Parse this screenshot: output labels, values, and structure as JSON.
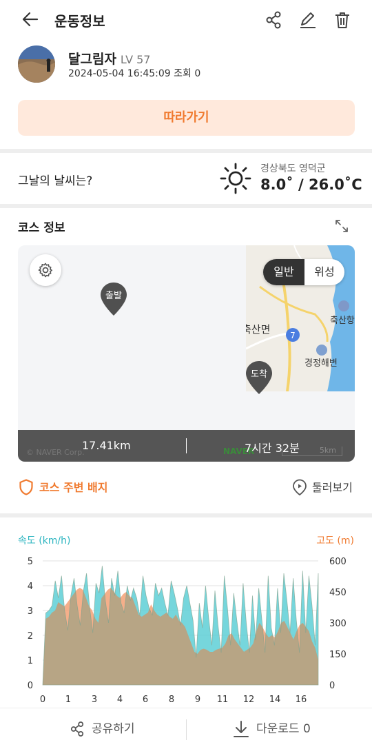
{
  "header": {
    "title": "운동정보"
  },
  "profile": {
    "name": "달그림자",
    "level": "LV 57",
    "meta": "2024-05-04 16:45:09 조회 0"
  },
  "follow_button": "따라가기",
  "weather": {
    "question": "그날의 날씨는?",
    "location": "경상북도 영덕군",
    "temperature": "8.0˚ / 26.0˚C"
  },
  "course": {
    "title": "코스 정보",
    "map_toggle": {
      "normal": "일반",
      "satellite": "위성"
    },
    "start_label": "출발",
    "end_label": "도착",
    "distance": "17.41km",
    "duration": "7시간 32분",
    "map_labels": {
      "place1": "축산항",
      "place2": "축산면",
      "beach": "경정해변",
      "route_no": "7"
    },
    "attribution": "© NAVER Corp.",
    "naver_mark": "NAVER",
    "scale": "5km"
  },
  "links": {
    "badge": "코스 주변 배지",
    "lookaround": "둘러보기"
  },
  "chart_data": {
    "type": "area",
    "ylabel_left": "속도 (km/h)",
    "ylabel_right": "고도 (m)",
    "x_ticks": [
      "0",
      "1",
      "3",
      "4",
      "6",
      "8",
      "9",
      "11",
      "12",
      "14",
      "16"
    ],
    "y_left_ticks": [
      "0",
      "1",
      "2",
      "3",
      "4",
      "5"
    ],
    "y_right_ticks": [
      "0",
      "150",
      "300",
      "450",
      "600"
    ],
    "ylim_left": [
      0,
      5
    ],
    "ylim_right": [
      0,
      600
    ],
    "colors": {
      "speed": "#5ecfd6",
      "altitude": "#f3a176",
      "overlap": "#b7a585"
    },
    "series": [
      {
        "values": [
          0,
          2.9,
          3,
          3.2,
          4.2,
          3.5,
          4.4,
          3,
          2.2,
          3.6,
          4.3,
          3.2,
          2.4,
          3.8,
          4.5,
          3.1,
          2.1,
          4.1,
          3.7,
          4.8,
          3.4,
          2.5,
          4.3,
          3.6,
          4.6,
          3.3,
          2.9,
          4,
          3.4,
          3.9,
          3.5,
          2.8,
          4.4,
          3.6,
          3.1,
          2.8,
          4.1,
          3.6,
          3.9,
          3.3,
          2.8,
          4.2,
          3.7,
          3.1,
          2.4,
          3.5,
          4,
          3.3,
          2.6,
          1.1,
          3.3,
          2.3,
          4,
          2.7,
          1.6,
          3.8,
          2.4,
          1.3,
          4.4,
          3.1,
          1.6,
          3.7,
          2.6,
          1.6,
          4.1,
          2.5,
          1.3,
          3.6,
          1.8,
          3.9,
          2.6,
          1.3,
          4.4,
          2.3,
          1.6,
          3.9,
          2.1,
          4.5,
          3.4,
          2.1,
          4.3,
          2.6,
          1.3,
          4.6,
          2.1,
          4.4,
          3.2,
          1.6,
          4.5
        ]
      },
      {
        "values": [
          0,
          320,
          330,
          350,
          360,
          400,
          390,
          380,
          400,
          420,
          440,
          460,
          470,
          460,
          420,
          380,
          360,
          320,
          300,
          420,
          440,
          460,
          470,
          450,
          430,
          420,
          440,
          450,
          430,
          420,
          380,
          340,
          330,
          340,
          350,
          390,
          360,
          340,
          330,
          340,
          350,
          330,
          320,
          340,
          310,
          300,
          280,
          240,
          200,
          160,
          150,
          170,
          175,
          170,
          160,
          160,
          170,
          175,
          180,
          200,
          240,
          250,
          220,
          200,
          180,
          160,
          170,
          180,
          200,
          260,
          300,
          280,
          250,
          230,
          240,
          230,
          260,
          300,
          310,
          280,
          250,
          220,
          260,
          290,
          300,
          280,
          260,
          210,
          180,
          120
        ]
      }
    ]
  }
}
